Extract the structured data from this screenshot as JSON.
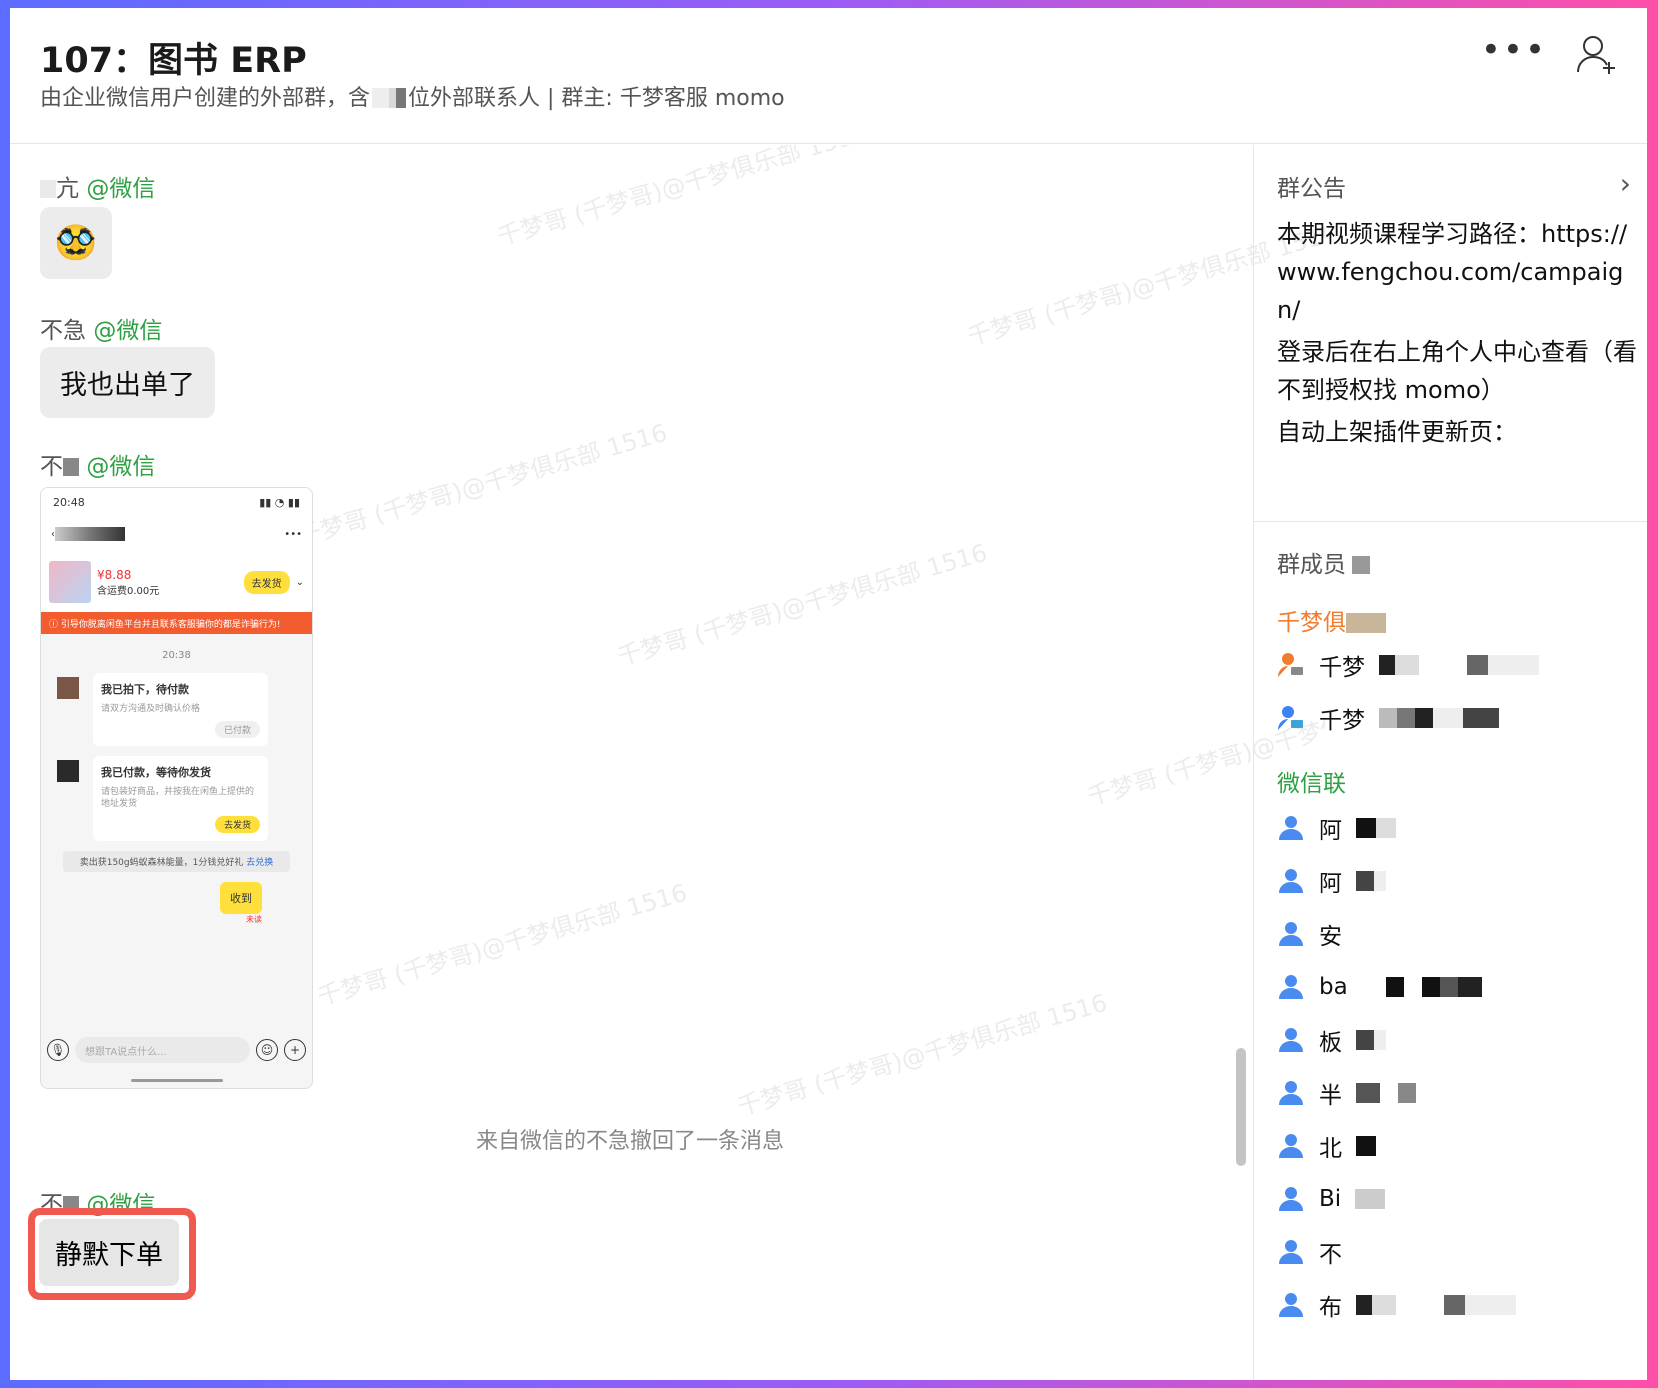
{
  "header": {
    "title": "107：图书 ERP",
    "subtitle_a": "由企业微信用户创建的外部群，含",
    "subtitle_b": "位外部联系人 | 群主: 千梦客服 momo",
    "more_label": "•••"
  },
  "chat": {
    "watermark": "千梦哥 (千梦哥)@千梦俱乐部 1516",
    "messages": [
      {
        "sender": "亢",
        "tag": "@微信",
        "emoji": "🥸"
      },
      {
        "sender": "不急",
        "tag": "@微信",
        "text": "我也出单了"
      },
      {
        "sender": "不",
        "tag": "@微信"
      }
    ],
    "screenshot": {
      "time": "20:48",
      "price": "¥8.88",
      "fee": "含运费0.00元",
      "ship_btn": "去发货",
      "warning": "引导你脱离闲鱼平台并且联系客服骗你的都是诈骗行为!",
      "chat_time": "20:38",
      "card1_title": "我已拍下，待付款",
      "card1_desc": "请双方沟通及时确认价格",
      "card1_btn": "已付款",
      "card2_title": "我已付款，等待你发货",
      "card2_desc": "请包装好商品，并按我在闲鱼上提供的地址发货",
      "card2_btn": "去发货",
      "tip": "卖出获150g蚂蚁森林能量，1分钱兑好礼",
      "tip_link": "去兑换",
      "received": "收到",
      "unread": "未读",
      "input_placeholder": "想跟TA说点什么..."
    },
    "recall_notice": "来自微信的不急撤回了一条消息",
    "last_sender": "不",
    "last_tag": "@微信",
    "last_text": "静默下单"
  },
  "side": {
    "notice_title": "群公告",
    "notice_lines": [
      "本期视频课程学习路径：https://www.fengchou.com/campaign/",
      "登录后在右上角个人中心查看（看不到授权找 momo）",
      "自动上架插件更新页："
    ],
    "members_title": "群成员",
    "group_qianmeng": "千梦俱",
    "group_wechat": "微信联",
    "members_qm": [
      "千梦",
      "千梦"
    ],
    "members_wx": [
      "阿",
      "阿",
      "安",
      "ba",
      "板",
      "半",
      "北",
      "Bi",
      "不",
      "布"
    ]
  }
}
